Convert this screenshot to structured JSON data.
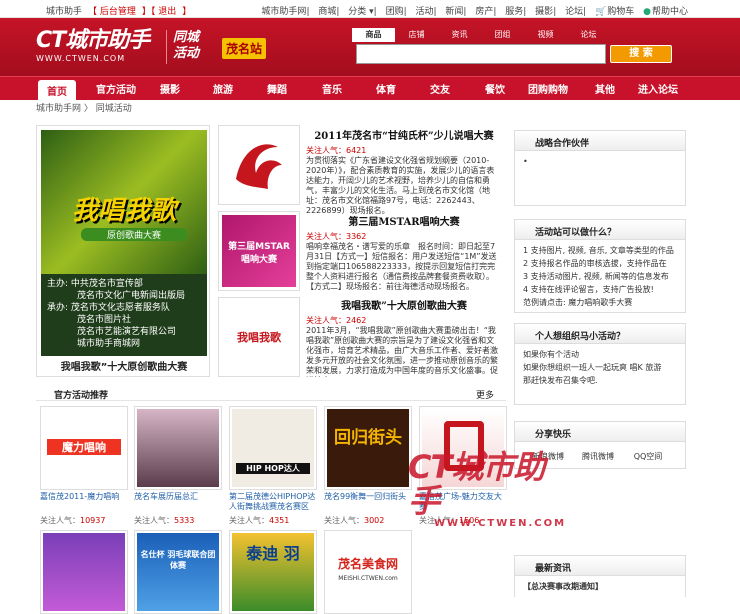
{
  "topbar": {
    "left": [
      "城市助手",
      "【 后台管理",
      "】【 退出",
      "】"
    ],
    "right": [
      "城市助手网",
      "商城",
      "分类 ▾",
      "团购",
      "活动",
      "新闻",
      "房产",
      "服务",
      "摄影",
      "论坛",
      "购物车",
      "帮助中心"
    ]
  },
  "header": {
    "logo_main": "CT城市助手",
    "logo_sub": "WWW.CTWEN.COM",
    "city_line1": "同城",
    "city_line2": "活动",
    "station": "茂名站",
    "search_tabs": [
      "商品",
      "店铺",
      "资讯",
      "团组",
      "视频",
      "论坛"
    ],
    "search_placeholder": "",
    "search_button": "搜 索"
  },
  "nav": [
    "首页",
    "官方活动",
    "摄影",
    "旅游",
    "舞蹈",
    "音乐",
    "体育",
    "交友",
    "餐饮",
    "团购购物",
    "其他",
    "进入论坛"
  ],
  "breadcrumb": "城市助手网 〉 同城活动",
  "feature": {
    "title": "我唱我歌",
    "subtitle": "原创歌曲大赛",
    "info": [
      "主办: 中共茂名市宣传部",
      "茂名市文化广电新闻出版局",
      "承办: 茂名市文化志愿者服务队",
      "茂名市图片社",
      "茂名市艺能演艺有限公司",
      "城市助手商城网"
    ],
    "caption": "我唱我歌”十大原创歌曲大赛"
  },
  "thumb_labels": [
    "",
    "第三届MSTAR唱响大赛",
    "我唱我歌"
  ],
  "news": [
    {
      "title": "2011年茂名市“甘纯氏杯”少儿说唱大赛",
      "pop_label": "关注人气：",
      "pop": "6421",
      "text": "为贯彻落实《广东省建设文化强省规划纲要（2010-2020年）》，配合素质教育的实施，发展少儿的语言表达能力，开阔少儿的艺术视野，培养少儿的自信和勇气，丰富少儿的文化生活。马上到茂名市文化馆（地址：茂名市文化馆福路97号，电话：2262443、2226899）现场报名。"
    },
    {
      "title": "第三届MSTAR唱响大赛",
      "pop_label": "关注人气：",
      "pop": "3362",
      "text": "唱响幸福茂名・谱写爱的乐章　报名时间：即日起至7月31日【方式一】短信报名：用户发送短信“1M”发送到指定端口106588223333，按提示回复短信打完完整个人资料进行报名（通信费按品牌套餐资费收取）。【方式二】现场报名：前往海德活动现场报名。"
    },
    {
      "title": "我唱我歌”十大原创歌曲大赛",
      "pop_label": "关注人气：",
      "pop": "2462",
      "text": "2011年3月，“我唱我歌”原创歌曲大赛重磅出击！“我唱我歌”原创歌曲大赛的宗旨是为了建设文化强省和文化强市，培育艺术精品，由广大音乐工作者、爱好者激发多元开放的社会文化氛围，进一步推动原创音乐的繁荣和发展，力求打造成为中国年度的音乐文化盛事。促进地方"
    }
  ],
  "section": {
    "title": "官方活动推荐",
    "more": "更多"
  },
  "grid": [
    {
      "name": "嘉信茂2011-魔力唱响",
      "pop_label": "关注人气：",
      "pop": "10937",
      "art": "魔力唱响"
    },
    {
      "name": "茂名车展历届总汇",
      "pop_label": "关注人气：",
      "pop": "5333",
      "art": ""
    },
    {
      "name": "第二届茂德公HIPHOP达人街舞挑战赛茂名赛区",
      "pop_label": "关注人气：",
      "pop": "4351",
      "art": "HIP HOP达人"
    },
    {
      "name": "茂名99衡舞一回归街头",
      "pop_label": "关注人气：",
      "pop": "3002",
      "art": "回归街头"
    },
    {
      "name": "嘉信茂广场-魅力交友大赛",
      "pop_label": "关注人气：",
      "pop": "1506",
      "art": ""
    },
    {
      "name": "",
      "pop_label": "",
      "pop": "",
      "art": ""
    },
    {
      "name": "",
      "pop_label": "",
      "pop": "",
      "art": "名仕杯 羽毛球联合团体赛"
    },
    {
      "name": "",
      "pop_label": "",
      "pop": "",
      "art": "泰迪 羽"
    },
    {
      "name": "",
      "pop_label": "",
      "pop": "",
      "art": "茂名美食网"
    },
    {
      "name": "",
      "pop_label": "",
      "pop": "",
      "art": "MEISHI.CTWEN.com"
    }
  ],
  "sidebar": {
    "partners": {
      "title": "战略合作伙伴",
      "items": [
        "•"
      ]
    },
    "howto": {
      "title": "活动站可以做什么？",
      "items": [
        "1 支持图片, 视频, 音乐, 文章等类型的作品",
        "2 支持报名作品的审核选拔，支持作品在",
        "3 支持活动图片, 视频, 新闻等的信息发布",
        "4 支持在线评论留言，支持广告投放!"
      ],
      "link": "范例请点击: 魔力唱响歌手大赛"
    },
    "organize": {
      "title": "个人想组织马小活动？",
      "items": [
        "如果你有个活动",
        "如果你想组织一班人一起玩爽 唱K 旅游",
        "那赶快发布召集令吧."
      ]
    },
    "share": {
      "title": "分享快乐",
      "items": [
        "新浪微博",
        "腾讯微博",
        "QQ空间"
      ]
    },
    "latest": {
      "title": "最新资讯",
      "items": [
        "【总决赛事改期通知】"
      ]
    }
  },
  "watermark": {
    "main": "CT城市助手",
    "sub": "WWW.CTWEN.COM"
  }
}
